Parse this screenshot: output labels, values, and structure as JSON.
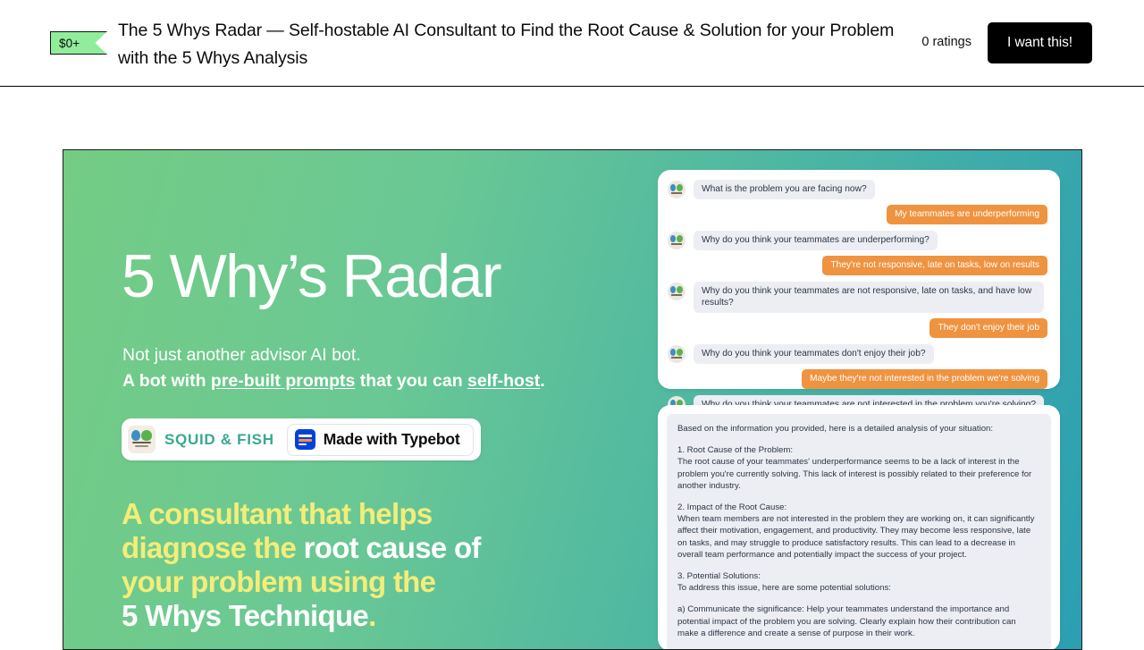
{
  "header": {
    "price_badge": "$0+",
    "title": "The 5 Whys Radar — Self-hostable AI Consultant to Find the Root Cause & Solution for your Problem with the 5 Whys Analysis",
    "ratings": "0 ratings",
    "cta_label": "I want this!"
  },
  "hero": {
    "heading": "5 Why’s Radar",
    "sub_line1": "Not just another advisor AI bot.",
    "sub_line2_a": "A bot with ",
    "sub_line2_b": "pre-built prompts",
    "sub_line2_c": " that you can ",
    "sub_line2_d": "self-host",
    "sub_line2_e": ".",
    "brand_badge": "SQUID & FISH",
    "typebot_badge": "Made with Typebot",
    "tagline_1": "A consultant that helps",
    "tagline_2a": "diagnose the ",
    "tagline_2b": "root cause of",
    "tagline_3": "your problem using the",
    "tagline_4a": "5 Whys Technique",
    "tagline_4b": ".",
    "colors": {
      "gradient_start": "#74cc84",
      "gradient_end": "#2b9fb2",
      "accent_yellow": "#f4ed7a",
      "user_bubble": "#ef9340",
      "bot_bubble": "#eceef3",
      "badge_green": "#90ee9a",
      "brand_teal": "#3aa88f",
      "typebot_blue": "#0042da"
    }
  },
  "chat": {
    "messages": [
      {
        "role": "bot",
        "text": "What is the problem you are facing now?"
      },
      {
        "role": "user",
        "text": "My teammates are underperforming"
      },
      {
        "role": "bot",
        "text": "Why do you think your teammates are underperforming?"
      },
      {
        "role": "user",
        "text": "They're not responsive, late on tasks, low on results"
      },
      {
        "role": "bot",
        "text": "Why do you think your teammates are not responsive, late on tasks, and have low results?"
      },
      {
        "role": "user",
        "text": "They don't enjoy their job"
      },
      {
        "role": "bot",
        "text": "Why do you think your teammates don't enjoy their job?"
      },
      {
        "role": "user",
        "text": "Maybe they're not interested in the problem we're solving"
      },
      {
        "role": "bot",
        "text": "Why do you think your teammates are not interested in the problem you're solving?"
      }
    ]
  },
  "analysis": {
    "paragraphs": [
      "Based on the information you provided, here is a detailed analysis of your situation:",
      "1. Root Cause of the Problem:\nThe root cause of your teammates' underperformance seems to be a lack of interest in the problem you're currently solving. This lack of interest is possibly related to their preference for another industry.",
      "2. Impact of the Root Cause:\nWhen team members are not interested in the problem they are working on, it can significantly affect their motivation, engagement, and productivity. They may become less responsive, late on tasks, and may struggle to produce satisfactory results. This can lead to a decrease in overall team performance and potentially impact the success of your project.",
      "3. Potential Solutions:\nTo address this issue, here are some potential solutions:",
      "a) Communicate the significance: Help your teammates understand the importance and potential impact of the problem you are solving. Clearly explain how their contribution can make a difference and create a sense of purpose in their work."
    ]
  }
}
